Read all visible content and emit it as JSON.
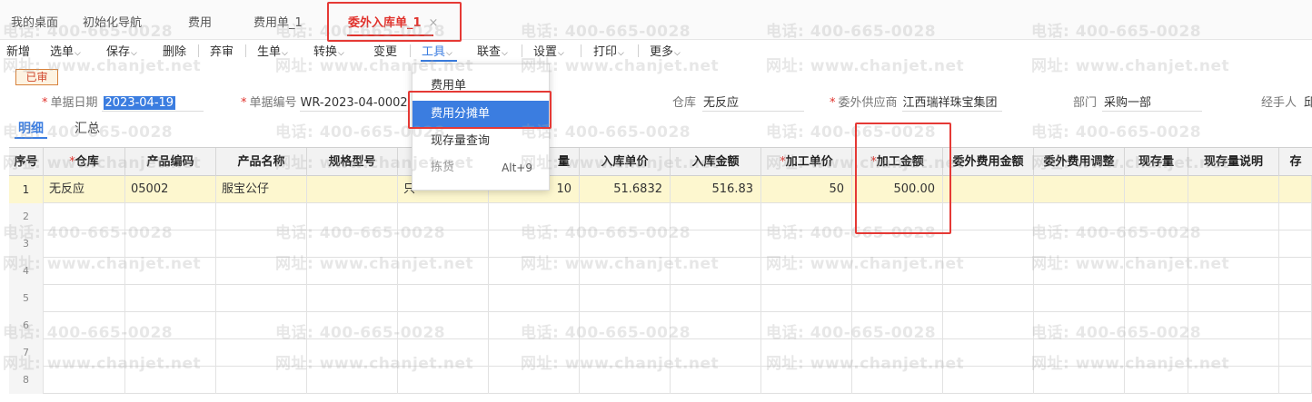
{
  "tabs": [
    {
      "label": "我的桌面"
    },
    {
      "label": "初始化导航"
    },
    {
      "label": "费用"
    },
    {
      "label": "费用单_1"
    },
    {
      "label": "委外入库单_1",
      "active": true,
      "close_glyph": "×"
    }
  ],
  "toolbar": {
    "items": [
      "新增",
      "选单",
      "保存",
      "删除",
      "弃审",
      "生单",
      "转换",
      "变更",
      "工具",
      "联查",
      "设置",
      "打印",
      "更多"
    ],
    "active_item": "工具"
  },
  "tools_menu": {
    "items": [
      {
        "label": "费用单"
      },
      {
        "label": "费用分摊单",
        "active": true
      },
      {
        "label": "现存量查询"
      },
      {
        "label": "拣货",
        "shortcut": "Alt+9",
        "disabled": true
      }
    ]
  },
  "status_badge": "已审",
  "form": {
    "date": {
      "label": "单据日期",
      "value": "2023-04-19",
      "required": true
    },
    "number": {
      "label": "单据编号",
      "value": "WR-2023-04-0002",
      "required": true
    },
    "warehouse": {
      "label": "仓库",
      "value": "无反应"
    },
    "supplier": {
      "label": "委外供应商",
      "value": "江西瑞祥珠宝集团",
      "required": true
    },
    "department": {
      "label": "部门",
      "value": "采购一部"
    },
    "handler": {
      "label": "经手人",
      "value": "邱"
    }
  },
  "sub_tabs": [
    "明细",
    "汇总"
  ],
  "grid": {
    "columns": [
      {
        "label": "序号"
      },
      {
        "label": "仓库",
        "required": true
      },
      {
        "label": "产品编码"
      },
      {
        "label": "产品名称"
      },
      {
        "label": "规格型号"
      },
      {
        "label": ""
      },
      {
        "label": "量"
      },
      {
        "label": "入库单价"
      },
      {
        "label": "入库金额"
      },
      {
        "label": "加工单价",
        "required": true
      },
      {
        "label": "加工金额",
        "required": true
      },
      {
        "label": "委外费用金额"
      },
      {
        "label": "委外费用调整"
      },
      {
        "label": "现存量"
      },
      {
        "label": "现存量说明"
      },
      {
        "label": "存"
      }
    ],
    "rows": [
      {
        "idx": "1",
        "warehouse": "无反应",
        "code": "05002",
        "name": "服宝公仔",
        "spec": "",
        "unit": "只",
        "qty": "10",
        "in_price": "51.6832",
        "in_amount": "516.83",
        "proc_price": "50",
        "proc_amount": "500.00"
      },
      {
        "idx": "2"
      },
      {
        "idx": "3"
      },
      {
        "idx": "4"
      },
      {
        "idx": "5"
      },
      {
        "idx": "6"
      },
      {
        "idx": "7"
      },
      {
        "idx": "8"
      }
    ]
  },
  "watermark": {
    "phone": "电话: 400-665-0028",
    "site": "网址: www.chanjet.net"
  },
  "colors": {
    "accent": "#3b7de0",
    "active_tab": "#e0312b",
    "highlight_box": "#e53935",
    "selected_row": "#fdf7cf"
  }
}
